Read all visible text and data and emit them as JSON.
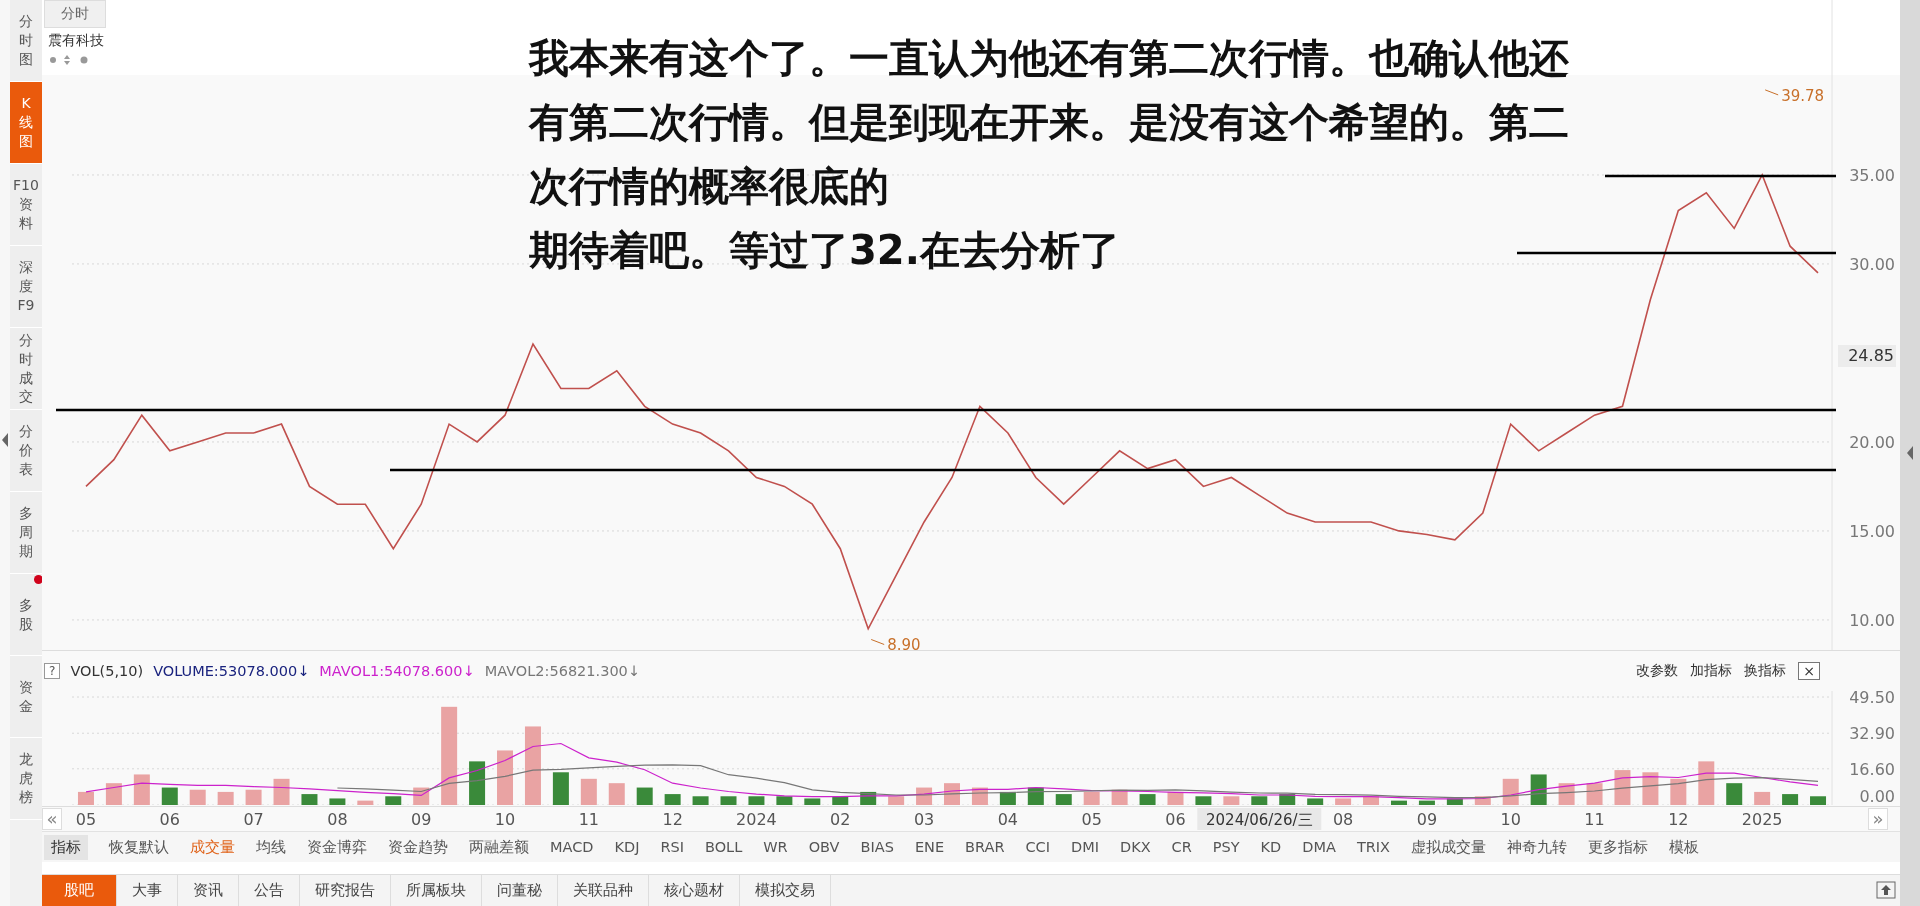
{
  "sidebar": {
    "items": [
      {
        "label": "分时图",
        "selected": false,
        "alert": false
      },
      {
        "label": "K线图",
        "selected": true,
        "alert": false
      },
      {
        "label": "F10资料",
        "selected": false,
        "alert": false
      },
      {
        "label": "深度F9",
        "selected": false,
        "alert": false
      },
      {
        "label": "分时成交",
        "selected": false,
        "alert": false
      },
      {
        "label": "分价表",
        "selected": false,
        "alert": false
      },
      {
        "label": "多周期",
        "selected": false,
        "alert": false
      },
      {
        "label": "多股",
        "selected": false,
        "alert": true
      },
      {
        "label": "资金",
        "selected": false,
        "alert": false
      },
      {
        "label": "龙虎榜",
        "selected": false,
        "alert": false
      }
    ]
  },
  "top_tab": {
    "label": "分时"
  },
  "stock_name": "震有科技",
  "note": {
    "lines": [
      "我本来有这个了。一直认为他还有第二次行情。也确认他还",
      "有第二次行情。但是到现在开来。是没有这个希望的。第二",
      "次行情的概率很底的",
      "期待着吧。等过了32.在去分析了"
    ]
  },
  "price_chart": {
    "last_price": "24.85",
    "chart_data": {
      "type": "line",
      "grid": true,
      "series": [
        {
          "color": "#c0504d",
          "values": [
            17.5,
            19,
            21.5,
            19.5,
            20,
            20.5,
            20.5,
            21,
            17.5,
            16.5,
            16.5,
            14,
            16.5,
            21,
            20,
            21.5,
            25.5,
            23,
            23,
            24,
            22,
            21,
            20.5,
            19.5,
            18,
            17.5,
            16.5,
            14,
            9.5,
            12.5,
            15.5,
            18,
            22,
            20.5,
            18,
            16.5,
            18,
            19.5,
            18.5,
            19,
            17.5,
            18,
            17,
            16,
            15.5,
            15.5,
            15.5,
            15,
            14.8,
            14.5,
            16,
            21,
            19.5,
            20.5,
            21.5,
            22,
            28,
            33,
            34,
            32,
            35,
            31,
            29.5
          ]
        }
      ],
      "ylim": [
        8.31,
        44.83
      ],
      "yticks": [
        {
          "value": 10,
          "label": "10.00"
        },
        {
          "value": 15,
          "label": "15.00"
        },
        {
          "value": 20,
          "label": "20.00"
        },
        {
          "value": 30,
          "label": "30.00"
        },
        {
          "value": 35,
          "label": "35.00"
        }
      ],
      "annotations": [
        "39.78",
        "8.90"
      ]
    }
  },
  "volume_panel": {
    "help": "?",
    "legend": [
      {
        "text": "VOL(5,10)",
        "color": "#333333"
      },
      {
        "text": "VOLUME:53078.000↓",
        "color": "#1a237e"
      },
      {
        "text": "MAVOL1:54078.600↓",
        "color": "#cc22cc"
      },
      {
        "text": "MAVOL2:56821.300↓",
        "color": "#777777"
      }
    ],
    "actions": [
      "改参数",
      "加指标",
      "换指标"
    ],
    "close": "×",
    "chart_data": {
      "type": "bar",
      "grid": true,
      "series": [
        {
          "colors": [
            "#e9a3a3",
            "#e9a3a3",
            "#e9a3a3",
            "#3a8a3a",
            "#e9a3a3",
            "#e9a3a3",
            "#e9a3a3",
            "#e9a3a3",
            "#3a8a3a",
            "#3a8a3a",
            "#e9a3a3",
            "#3a8a3a",
            "#e9a3a3",
            "#e9a3a3",
            "#3a8a3a",
            "#e9a3a3",
            "#e9a3a3",
            "#3a8a3a",
            "#e9a3a3",
            "#e9a3a3",
            "#3a8a3a",
            "#3a8a3a",
            "#3a8a3a",
            "#3a8a3a",
            "#3a8a3a",
            "#3a8a3a",
            "#3a8a3a",
            "#3a8a3a",
            "#3a8a3a",
            "#e9a3a3",
            "#e9a3a3",
            "#e9a3a3",
            "#e9a3a3",
            "#3a8a3a",
            "#3a8a3a",
            "#3a8a3a",
            "#e9a3a3",
            "#e9a3a3",
            "#3a8a3a",
            "#e9a3a3",
            "#3a8a3a",
            "#e9a3a3",
            "#3a8a3a",
            "#3a8a3a",
            "#3a8a3a",
            "#e9a3a3",
            "#e9a3a3",
            "#3a8a3a",
            "#3a8a3a",
            "#3a8a3a",
            "#e9a3a3",
            "#e9a3a3",
            "#3a8a3a",
            "#e9a3a3",
            "#e9a3a3",
            "#e9a3a3",
            "#e9a3a3",
            "#e9a3a3",
            "#e9a3a3",
            "#3a8a3a",
            "#e9a3a3",
            "#3a8a3a",
            "#3a8a3a"
          ],
          "values": [
            6,
            10,
            14,
            8,
            7,
            6,
            7,
            12,
            5,
            3,
            2,
            4,
            8,
            45,
            20,
            25,
            36,
            15,
            12,
            10,
            8,
            5,
            4,
            4,
            4,
            4,
            3,
            4,
            6,
            4,
            8,
            10,
            8,
            6,
            8,
            5,
            6,
            7,
            5,
            6,
            4,
            4,
            4,
            5,
            3,
            3,
            4,
            2,
            2,
            3,
            4,
            12,
            14,
            10,
            10,
            16,
            15,
            12,
            20,
            10,
            6,
            5,
            4
          ]
        },
        {
          "type": "line",
          "color": "#cc22cc",
          "values": [
            6,
            8,
            10,
            9.5,
            9,
            9,
            8.4,
            8,
            7.4,
            6.6,
            5.8,
            5.2,
            4.4,
            12.4,
            15.8,
            20.4,
            26.8,
            28.2,
            21.6,
            19.6,
            16.2,
            10,
            7.8,
            6.2,
            5,
            4.2,
            3.8,
            3.8,
            4.2,
            4.2,
            5,
            6.4,
            7.2,
            7.2,
            8,
            7.4,
            6.6,
            6.4,
            6.2,
            5.8,
            5.6,
            5.2,
            4.6,
            4.6,
            4,
            3.8,
            3.8,
            3.4,
            2.8,
            2.8,
            3,
            4.6,
            7,
            8.6,
            10,
            12.4,
            13,
            12.6,
            14.6,
            14.6,
            12.6,
            10.6,
            9
          ]
        },
        {
          "type": "line",
          "color": "#777777",
          "values": [
            null,
            null,
            null,
            null,
            null,
            null,
            null,
            null,
            null,
            7.8,
            7.4,
            6.8,
            6.2,
            9.9,
            11.2,
            13.1,
            16,
            16.3,
            17,
            17.7,
            18.3,
            18.4,
            18,
            13.9,
            12.3,
            10.2,
            6.9,
            5.8,
            5.2,
            4.6,
            4.6,
            5.1,
            5.5,
            5.7,
            6.1,
            6.2,
            6.5,
            6.8,
            6.7,
            6.9,
            6.5,
            5.9,
            5.5,
            5.4,
            4.9,
            4.7,
            4.5,
            4,
            3.7,
            3.4,
            3.4,
            4.2,
            5.2,
            5.7,
            6.4,
            7.7,
            8.8,
            9.8,
            11.6,
            12.3,
            12.5,
            11.8,
            10.8
          ]
        }
      ],
      "ylim": [
        0,
        52.25
      ],
      "yticks": [
        {
          "value": 0,
          "label": "0.00"
        },
        {
          "value": 16.6,
          "label": "16.60"
        },
        {
          "value": 32.9,
          "label": "32.90"
        },
        {
          "value": 49.5,
          "label": "49.50"
        }
      ]
    }
  },
  "x_axis": {
    "scroll_left": "«",
    "scroll_right": "»",
    "cursor_date": "2024/06/26/三",
    "ticks": [
      {
        "label": "05"
      },
      {
        "label": "06"
      },
      {
        "label": "07"
      },
      {
        "label": "08"
      },
      {
        "label": "09"
      },
      {
        "label": "10"
      },
      {
        "label": "11"
      },
      {
        "label": "12"
      },
      {
        "label": "2024"
      },
      {
        "label": "02"
      },
      {
        "label": "03"
      },
      {
        "label": "04"
      },
      {
        "label": "05"
      },
      {
        "label": "06"
      },
      {
        "cursor": true
      },
      {
        "label": "08"
      },
      {
        "label": "09"
      },
      {
        "label": "10"
      },
      {
        "label": "11"
      },
      {
        "label": "12"
      },
      {
        "label": "2025"
      }
    ]
  },
  "indicator_bar": {
    "label": "指标",
    "tabs": [
      {
        "label": "恢复默认",
        "selected": false
      },
      {
        "label": "成交量",
        "selected": true
      },
      {
        "label": "均线",
        "selected": false
      },
      {
        "label": "资金博弈",
        "selected": false
      },
      {
        "label": "资金趋势",
        "selected": false
      },
      {
        "label": "两融差额",
        "selected": false
      },
      {
        "label": "MACD",
        "selected": false
      },
      {
        "label": "KDJ",
        "selected": false
      },
      {
        "label": "RSI",
        "selected": false
      },
      {
        "label": "BOLL",
        "selected": false
      },
      {
        "label": "WR",
        "selected": false
      },
      {
        "label": "OBV",
        "selected": false
      },
      {
        "label": "BIAS",
        "selected": false
      },
      {
        "label": "ENE",
        "selected": false
      },
      {
        "label": "BRAR",
        "selected": false
      },
      {
        "label": "CCI",
        "selected": false
      },
      {
        "label": "DMI",
        "selected": false
      },
      {
        "label": "DKX",
        "selected": false
      },
      {
        "label": "CR",
        "selected": false
      },
      {
        "label": "PSY",
        "selected": false
      },
      {
        "label": "KD",
        "selected": false
      },
      {
        "label": "DMA",
        "selected": false
      },
      {
        "label": "TRIX",
        "selected": false
      },
      {
        "label": "虚拟成交量",
        "selected": false
      },
      {
        "label": "神奇九转",
        "selected": false
      },
      {
        "label": "更多指标",
        "selected": false
      },
      {
        "label": "模板",
        "selected": false
      }
    ]
  },
  "bottom_tabs": [
    {
      "label": "股吧",
      "selected": true
    },
    {
      "label": "大事",
      "selected": false
    },
    {
      "label": "资讯",
      "selected": false
    },
    {
      "label": "公告",
      "selected": false
    },
    {
      "label": "研究报告",
      "selected": false
    },
    {
      "label": "所属板块",
      "selected": false
    },
    {
      "label": "问董秘",
      "selected": false
    },
    {
      "label": "关联品种",
      "selected": false
    },
    {
      "label": "核心题材",
      "selected": false
    },
    {
      "label": "模拟交易",
      "selected": false
    }
  ]
}
